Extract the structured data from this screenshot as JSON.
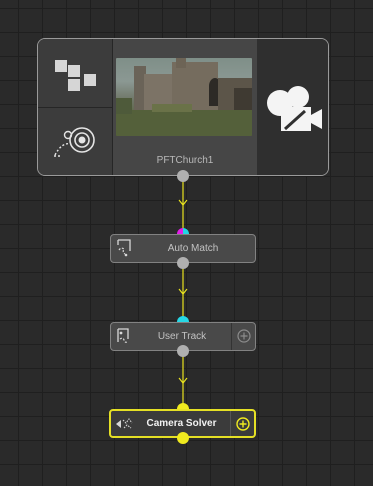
{
  "source_node": {
    "label": "PFTChurch1",
    "thumbnail_icon": "church-thumbnail",
    "left_top_icon": "grid-squares-icon",
    "left_bottom_icon": "lens-distortion-icon",
    "right_icon": "movie-camera-icon"
  },
  "nodes": {
    "auto_match": {
      "label": "Auto Match",
      "icon": "auto-match-icon"
    },
    "user_track": {
      "label": "User Track",
      "icon": "user-track-icon",
      "add_icon": "plus-circle-icon"
    },
    "camera_solver": {
      "label": "Camera Solver",
      "icon": "camera-solver-icon",
      "add_icon": "plus-circle-icon",
      "selected": true
    }
  },
  "colors": {
    "selection": "#e5e025",
    "wire": "#e8e21e",
    "port_magenta": "#e21ee8",
    "port_cyan": "#20d6e6",
    "port_gray": "#b0b0b0"
  }
}
